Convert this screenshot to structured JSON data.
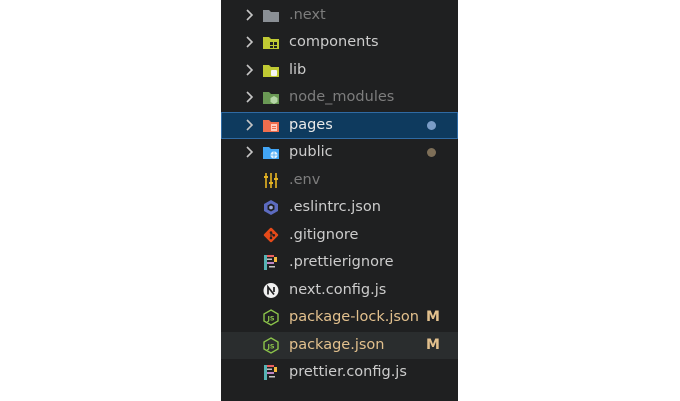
{
  "explorer": {
    "items": [
      {
        "label": ".next",
        "type": "folder",
        "icon": "next-folder-icon"
      },
      {
        "label": "components",
        "type": "folder",
        "icon": "components-folder-icon"
      },
      {
        "label": "lib",
        "type": "folder",
        "icon": "lib-folder-icon"
      },
      {
        "label": "node_modules",
        "type": "folder",
        "icon": "node-folder-icon"
      },
      {
        "label": "pages",
        "type": "folder",
        "icon": "pages-folder-icon",
        "selected": true,
        "status_dot_color": "#7a9cc6"
      },
      {
        "label": "public",
        "type": "folder",
        "icon": "public-folder-icon",
        "status_dot_color": "#7e6f58"
      },
      {
        "label": ".env",
        "type": "file",
        "icon": "env-file-icon"
      },
      {
        "label": ".eslintrc.json",
        "type": "file",
        "icon": "eslint-file-icon"
      },
      {
        "label": ".gitignore",
        "type": "file",
        "icon": "git-file-icon"
      },
      {
        "label": ".prettierignore",
        "type": "file",
        "icon": "prettier-file-icon"
      },
      {
        "label": "next.config.js",
        "type": "file",
        "icon": "next-file-icon"
      },
      {
        "label": "package-lock.json",
        "type": "file",
        "icon": "node-file-icon",
        "badge": "M"
      },
      {
        "label": "package.json",
        "type": "file",
        "icon": "node-file-icon",
        "badge": "M"
      },
      {
        "label": "prettier.config.js",
        "type": "file",
        "icon": "prettier-file-icon"
      }
    ]
  },
  "colors": {
    "panel_bg": "#1f2021",
    "selected_bg": "#0e3a5e",
    "modified_text": "#e2c08d",
    "dim_text": "#7d7d7d",
    "text": "#cccccc"
  }
}
